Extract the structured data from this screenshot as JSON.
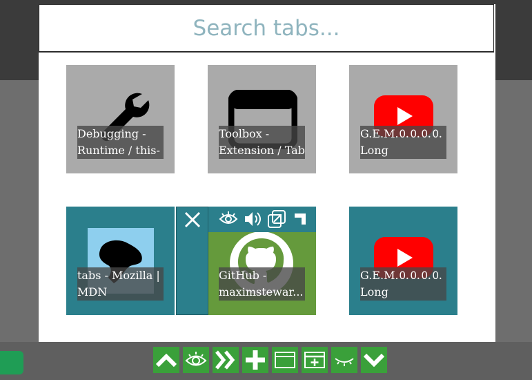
{
  "search": {
    "placeholder": "Search tabs..."
  },
  "tabs": [
    {
      "title": "Debugging - Runtime / this-",
      "favicon": "wrench-icon",
      "style": "gray"
    },
    {
      "title": "Toolbox - Extension / Tab",
      "favicon": "browser-window-icon",
      "style": "gray"
    },
    {
      "title": "G.E.M.🄀🄀🄀🄀 Long",
      "favicon": "youtube-icon",
      "style": "gray"
    },
    {
      "title": "tabs - Mozilla | MDN",
      "favicon": "mdn-dino-icon",
      "style": "teal"
    },
    {
      "title": "GitHub - maximstewar...",
      "favicon": "github-icon",
      "style": "green"
    },
    {
      "title": "G.E.M.🄀🄀🄀🄀 Long",
      "favicon": "youtube-icon",
      "style": "teal"
    }
  ],
  "tab_controls": [
    "close-icon",
    "eye-icon",
    "speaker-icon",
    "open-copy-icon",
    "corner-icon"
  ],
  "toolbar": [
    "chevron-up-icon",
    "eye-icon",
    "double-chevron-right-icon",
    "plus-icon",
    "window-icon",
    "new-window-icon",
    "eye-closed-icon",
    "chevron-down-icon"
  ],
  "colors": {
    "tile_gray": "#aaaaaa",
    "tile_teal": "#2b7f8c",
    "tile_green": "#659a3c",
    "toolbar_green": "#3aa03a",
    "placeholder": "#8fb4be"
  }
}
